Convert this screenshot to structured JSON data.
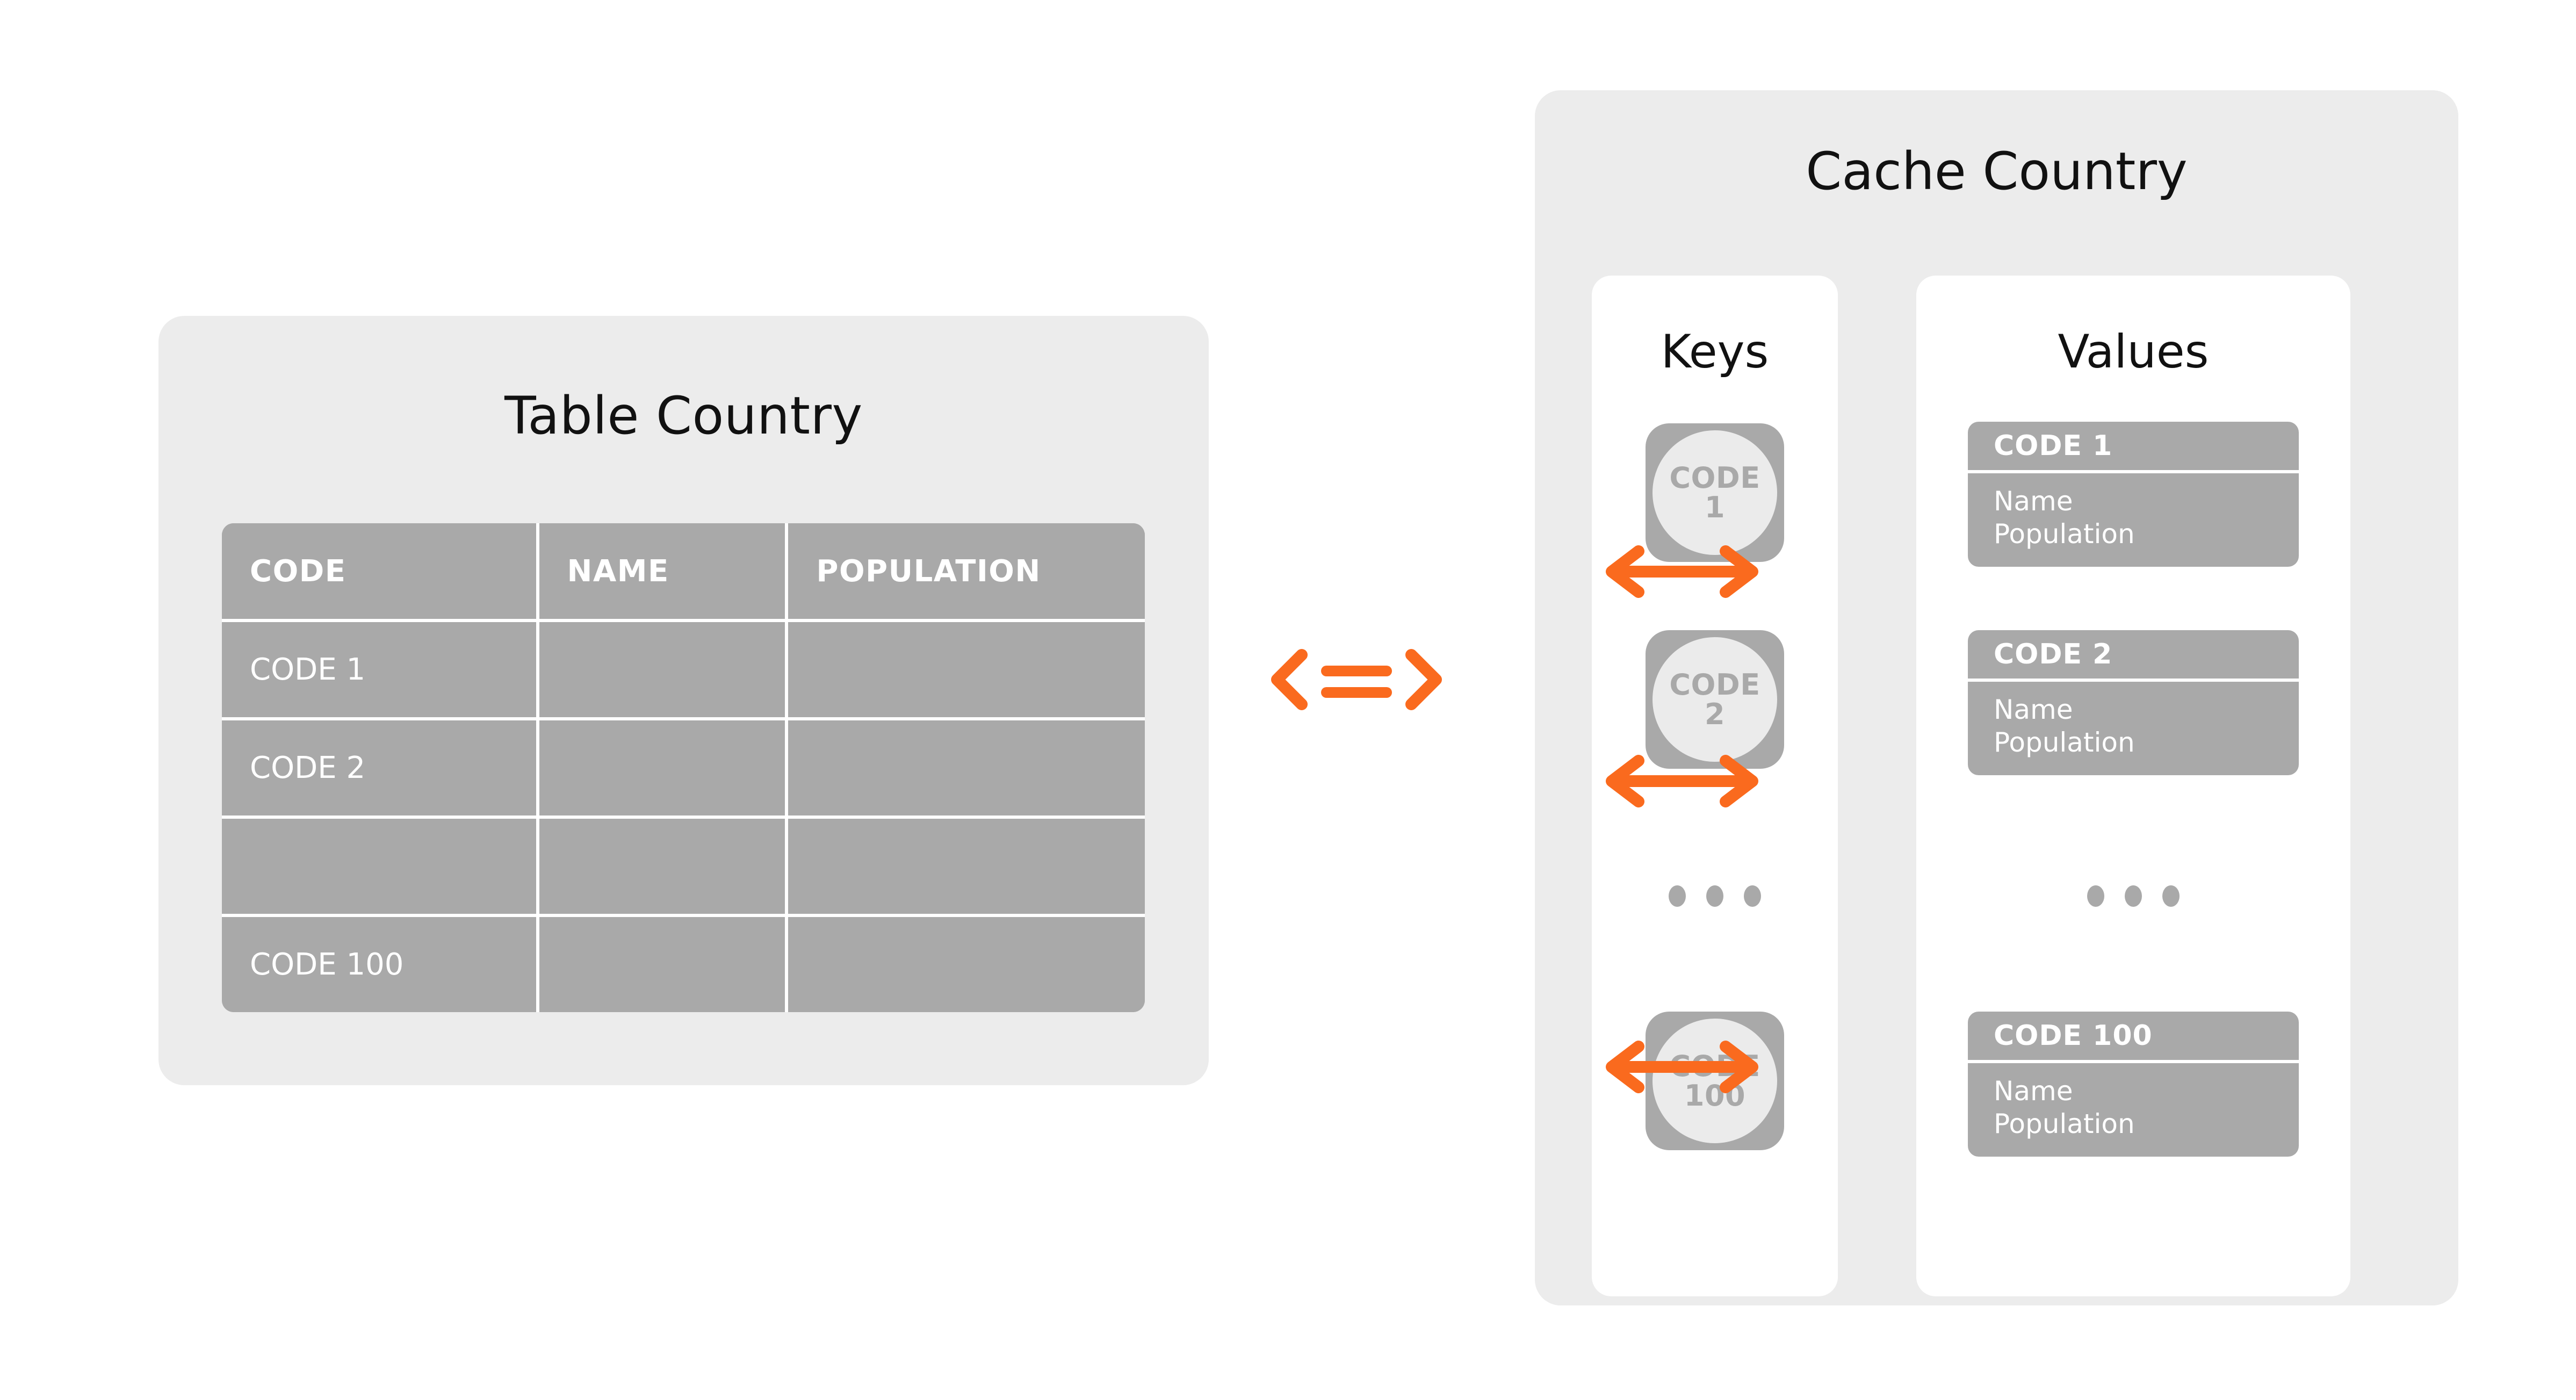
{
  "colors": {
    "panel_bg": "#ECECEC",
    "card_bg": "#FFFFFF",
    "gray_fill": "#A9A9A9",
    "badge_inner": "#EBEBEB",
    "accent_orange": "#FA6A1E",
    "text_dark": "#111111",
    "text_light": "#FFFFFF"
  },
  "left_panel": {
    "title": "Table Country",
    "table": {
      "headers": [
        "CODE",
        "NAME",
        "POPULATION"
      ],
      "rows": [
        [
          "CODE 1",
          "",
          ""
        ],
        [
          "CODE 2",
          "",
          ""
        ],
        [
          "",
          "",
          ""
        ],
        [
          "CODE 100",
          "",
          ""
        ]
      ]
    }
  },
  "center": {
    "equivalence_icon": "double-arrow-equivalence-icon",
    "equivalence_label": "<=>"
  },
  "right_panel": {
    "title": "Cache Country",
    "keys_column": {
      "heading": "Keys",
      "badges": [
        {
          "line1": "CODE",
          "line2": "1"
        },
        {
          "line1": "CODE",
          "line2": "2"
        },
        {
          "line1": "CODE",
          "line2": "100"
        }
      ],
      "ellipsis": "•••"
    },
    "values_column": {
      "heading": "Values",
      "cards": [
        {
          "header": "CODE 1",
          "body_line1": "Name",
          "body_line2": "Population"
        },
        {
          "header": "CODE 2",
          "body_line1": "Name",
          "body_line2": "Population"
        },
        {
          "header": "CODE 100",
          "body_line1": "Name",
          "body_line2": "Population"
        }
      ],
      "ellipsis": "•••"
    },
    "connectors": [
      {
        "icon": "bidirectional-arrow-icon"
      },
      {
        "icon": "bidirectional-arrow-icon"
      },
      {
        "icon": "bidirectional-arrow-icon"
      }
    ]
  }
}
